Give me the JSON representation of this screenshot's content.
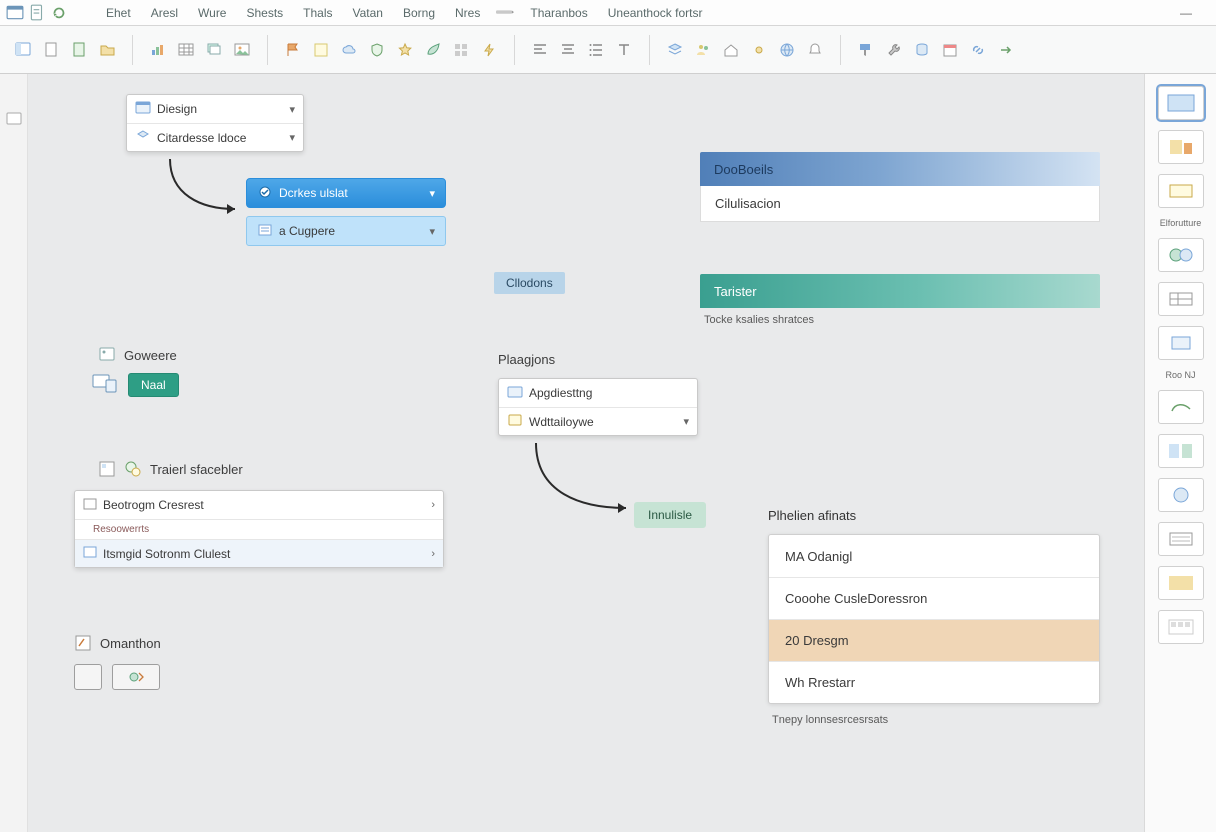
{
  "menu": {
    "items": [
      "Ehet",
      "Aresl",
      "Wure",
      "Shests",
      "Thals",
      "Vatan",
      "Borng",
      "Nres",
      "Tharanbos",
      "Uneanthock fortsr"
    ]
  },
  "dropdown1": {
    "items": [
      "Diesign",
      "Citardesse ldoce"
    ]
  },
  "dropdown2": {
    "highlight": "Dcrkes ulslat",
    "sub": "a Cugpere"
  },
  "tag_clodons": "Cllodons",
  "blue_header": {
    "title": "DooBoeils"
  },
  "blue_row": {
    "label": "Cilulisacion"
  },
  "teal_bar": {
    "label": "Tarister"
  },
  "teal_caption": "Tocke ksalies shratces",
  "gowere": {
    "title": "Goweere",
    "pill": "Naal"
  },
  "trailer": {
    "title": "Traierl sfacebler",
    "rows": [
      "Beotrogm Cresrest",
      "Resoowerrts",
      "Itsmgid Sotronm Clulest"
    ]
  },
  "onation": {
    "title": "Omanthon"
  },
  "plagons": {
    "title": "Plaagjons",
    "items": [
      "Apgdiesttng",
      "Wdttailoywe"
    ]
  },
  "innusle": "Innulisle",
  "phelien": {
    "title": "Plhelien afinats",
    "rows": [
      "MA Odanigl",
      "Cooohe CusleDoressron",
      "20 Dresgm",
      "Wh Rrestarr"
    ],
    "caption": "Tnepy lonnsesrcesrsats"
  },
  "right_labels": {
    "a": "Elforutture",
    "b": "Roo  NJ"
  }
}
